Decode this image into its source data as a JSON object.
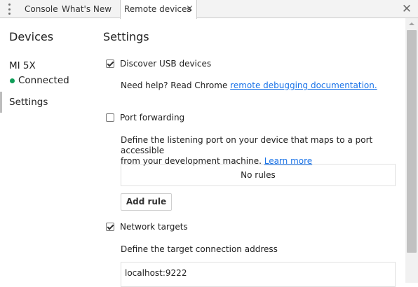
{
  "tabbar": {
    "menu_icon": "kebab-vertical-icon",
    "tabs": [
      {
        "label": "Console"
      },
      {
        "label": "What's New"
      },
      {
        "label": "Remote devices",
        "close": "×",
        "active": true
      }
    ],
    "panel_close": "✕"
  },
  "sidebar": {
    "title": "Devices",
    "device": {
      "name": "MI 5X",
      "status": "Connected",
      "status_color": "#0f9d58"
    },
    "settings_label": "Settings"
  },
  "main": {
    "title": "Settings",
    "discover_usb": {
      "label": "Discover USB devices",
      "checked": true,
      "help_prefix": "Need help? Read Chrome ",
      "help_link": "remote debugging documentation."
    },
    "port_forwarding": {
      "label": "Port forwarding",
      "checked": false,
      "description_line1": "Define the listening port on your device that maps to a port accessible",
      "description_line2": "from your development machine. ",
      "learn_more": "Learn more",
      "rules_empty": "No rules",
      "add_rule": "Add rule"
    },
    "network_targets": {
      "label": "Network targets",
      "checked": true,
      "description": "Define the target connection address",
      "target_value": "localhost:9222"
    }
  },
  "colors": {
    "link": "#1a73e8",
    "accent_status": "#0f9d58"
  }
}
